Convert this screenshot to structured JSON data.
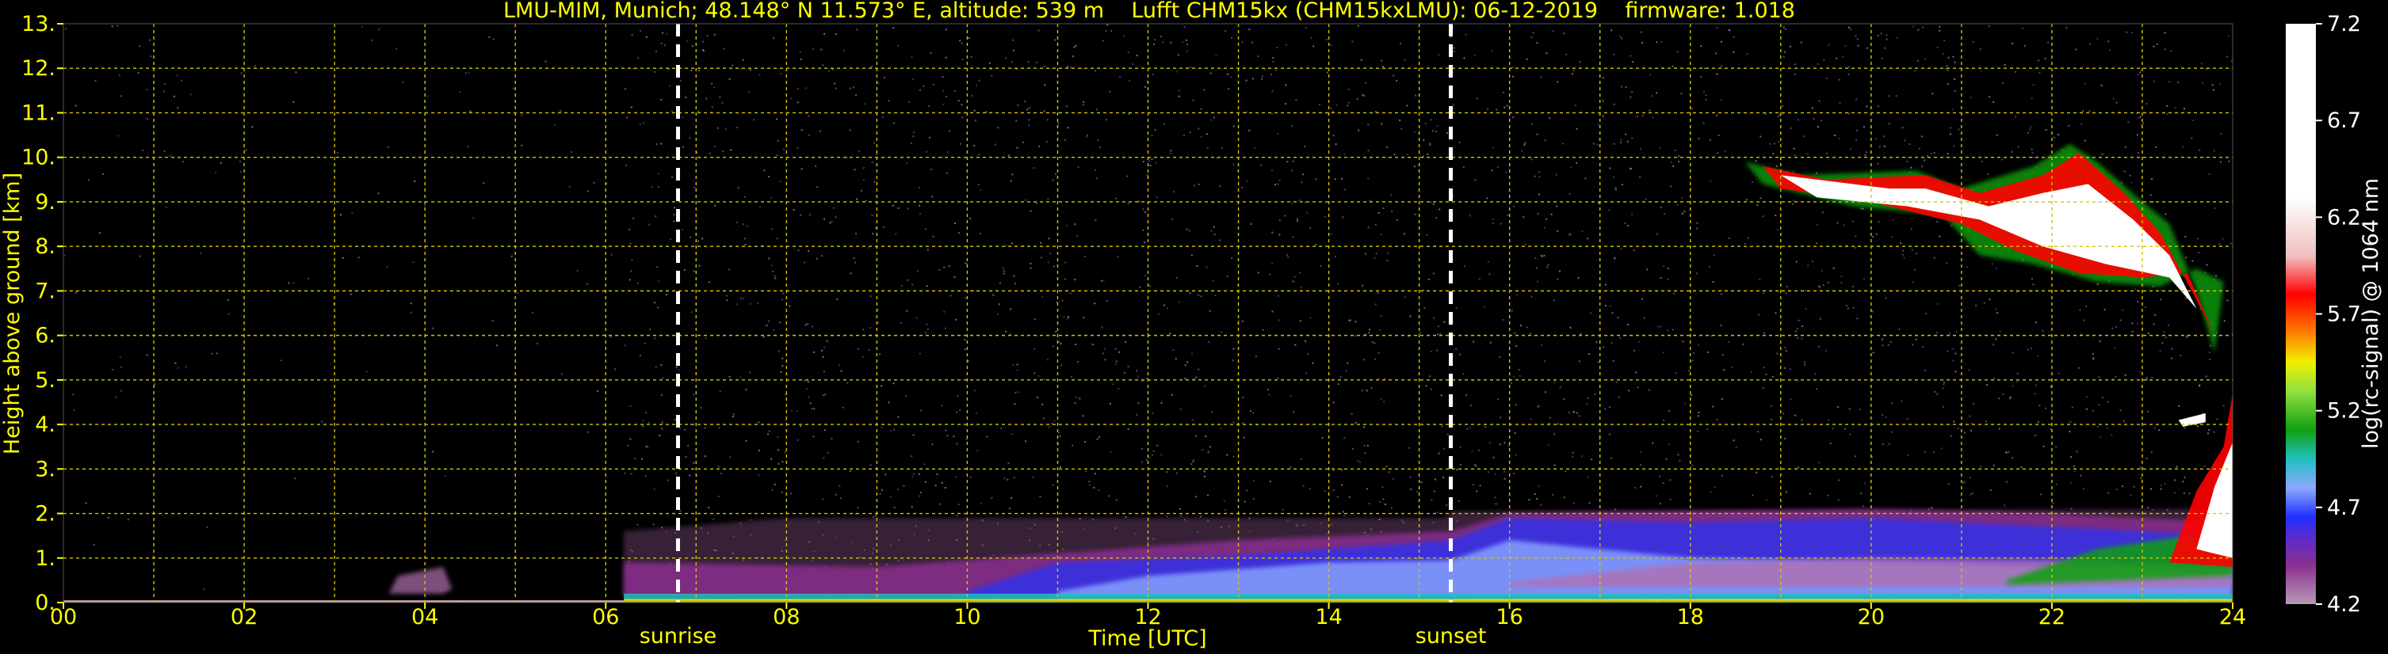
{
  "chart_data": {
    "type": "heatmap",
    "title": "LMU-MIM, Munich; 48.148° N 11.573° E, altitude: 539 m    Lufft CHM15kx (CHM15kxLMU): 06-12-2019    firmware: 1.018",
    "xlabel": "Time [UTC]",
    "ylabel": "Height above ground [km]",
    "xlim": [
      0,
      24
    ],
    "ylim": [
      0,
      13
    ],
    "x_ticks": [
      0,
      2,
      4,
      6,
      8,
      10,
      12,
      14,
      16,
      18,
      20,
      22,
      24
    ],
    "x_tick_labels": [
      "00",
      "02",
      "04",
      "06",
      "08",
      "10",
      "12",
      "14",
      "16",
      "18",
      "20",
      "22",
      "24"
    ],
    "y_ticks": [
      0,
      1,
      2,
      3,
      4,
      5,
      6,
      7,
      8,
      9,
      10,
      11,
      12,
      13
    ],
    "y_tick_labels": [
      "0.",
      "1.",
      "2.",
      "3.",
      "4.",
      "5.",
      "6.",
      "7.",
      "8.",
      "9.",
      "10.",
      "11.",
      "12.",
      "13."
    ],
    "grid": true,
    "markers": [
      {
        "label": "sunrise",
        "x": 6.8
      },
      {
        "label": "sunset",
        "x": 15.35
      }
    ],
    "colorbar": {
      "label": "log(rc-signal) @ 1064 nm",
      "range": [
        4.2,
        7.2
      ],
      "tick_values": [
        4.2,
        4.7,
        5.2,
        5.7,
        6.2,
        6.7,
        7.2
      ],
      "tick_labels": [
        "4.2",
        "4.7",
        "5.2",
        "5.7",
        "6.2",
        "6.7",
        "7.2"
      ],
      "stops": [
        {
          "value": 4.2,
          "color": "#b89ab8"
        },
        {
          "value": 4.4,
          "color": "#8a2f8f"
        },
        {
          "value": 4.55,
          "color": "#5a2bd0"
        },
        {
          "value": 4.65,
          "color": "#2030ff"
        },
        {
          "value": 4.8,
          "color": "#8aa8ff"
        },
        {
          "value": 4.95,
          "color": "#20c0c0"
        },
        {
          "value": 5.1,
          "color": "#10a010"
        },
        {
          "value": 5.3,
          "color": "#90e040"
        },
        {
          "value": 5.45,
          "color": "#f0f000"
        },
        {
          "value": 5.6,
          "color": "#ff8000"
        },
        {
          "value": 5.8,
          "color": "#ff0000"
        },
        {
          "value": 6.0,
          "color": "#f0c0c0"
        },
        {
          "value": 6.3,
          "color": "#ffffff"
        },
        {
          "value": 7.2,
          "color": "#ffffff"
        }
      ]
    },
    "features": [
      {
        "name": "boundary layer",
        "x_range": [
          6.2,
          24
        ],
        "height_range": [
          0,
          2.1
        ]
      },
      {
        "name": "cirrus cloud",
        "x_range": [
          18.6,
          23.9
        ],
        "height_range": [
          5.5,
          10.3
        ]
      },
      {
        "name": "low cloud",
        "x_range": [
          23.3,
          24
        ],
        "height_range": [
          0.8,
          4.7
        ]
      }
    ]
  },
  "colors": {
    "text": "#ffff00",
    "grid": "#d4c400",
    "marker": "#ffffff",
    "background": "#000000"
  }
}
